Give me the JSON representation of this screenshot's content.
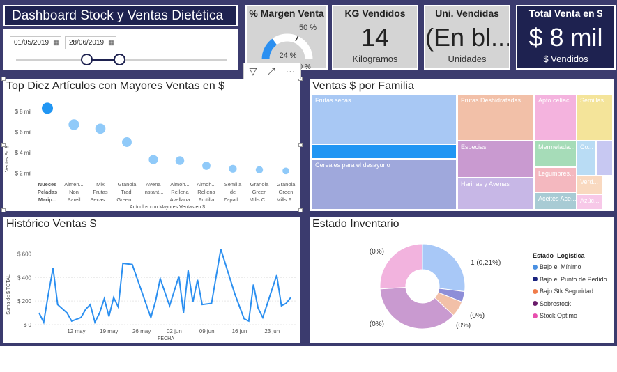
{
  "header": {
    "title": "Dashboard Stock y Ventas Dietética"
  },
  "slicer": {
    "start_date": "01/05/2019",
    "end_date": "28/06/2019",
    "calendar_icon": "calendar-icon"
  },
  "gauge": {
    "title": "% Margen Venta",
    "value_label": "24 %",
    "min_label": "0 %",
    "target_label": "50 %",
    "max_label": "80 %",
    "fill_fraction": 0.3
  },
  "cards": {
    "kg": {
      "title": "KG Vendidos",
      "value": "14",
      "unit": "Kilogramos"
    },
    "units": {
      "title": "Uni. Vendidas",
      "value": "(En bl...",
      "unit": "Unidades"
    },
    "total": {
      "title": "Total Venta en $",
      "value": "$ 8 mil",
      "unit": "$ Vendidos"
    }
  },
  "toolbar": {
    "filter_icon": "filter-icon",
    "focus_icon": "focus-mode-icon",
    "more_icon": "more-options-icon",
    "more_label": "···"
  },
  "top10": {
    "title": "Top Diez Artículos con Mayores Ventas en $",
    "xlabel": "Artículos con Mayores Ventas en $",
    "ylabel": "Ventas En $",
    "ticks": [
      "$ 8 mil",
      "$ 6 mil",
      "$ 4 mil",
      "$ 2 mil"
    ],
    "labels": [
      [
        "Nueces",
        "Peladas",
        "Marip..."
      ],
      [
        "Almen...",
        "Non",
        "Pareil"
      ],
      [
        "Mix",
        "Frutas",
        "Secas ..."
      ],
      [
        "Granola",
        "Trad.",
        "Green ..."
      ],
      [
        "Avena",
        "Instant..."
      ],
      [
        "Almoh...",
        "Rellena",
        "Avellana"
      ],
      [
        "Almoh...",
        "Rellena",
        "Frutilla"
      ],
      [
        "Semilla",
        "de",
        "Zapall..."
      ],
      [
        "Granola",
        "Green",
        "Mills C..."
      ],
      [
        "Granola",
        "Green",
        "Mills F..."
      ]
    ]
  },
  "historico": {
    "title": "Histórico Ventas $",
    "ylabel": "Suma de $ TOTAL",
    "xlabel": "FECHA",
    "yticks": [
      "$ 600",
      "$ 400",
      "$ 200",
      "$ 0"
    ],
    "xticks": [
      "12 may",
      "19 may",
      "26 may",
      "02 jun",
      "09 jun",
      "16 jun",
      "23 jun"
    ]
  },
  "familia": {
    "title": "Ventas $ por Familia",
    "tiles": [
      {
        "label": "Frutas secas",
        "color": "#a8c8f4"
      },
      {
        "label": "Cereales para el desayuno",
        "color": "#9fa8dc"
      },
      {
        "label": "Frutas Deshidratadas",
        "color": "#f2c0a8"
      },
      {
        "label": "Especias",
        "color": "#c99ad0"
      },
      {
        "label": "Harinas y Avenas",
        "color": "#c7b7e6"
      },
      {
        "label": "Apto celíac...",
        "color": "#f4b3de"
      },
      {
        "label": "Semillas",
        "color": "#f4e49a"
      },
      {
        "label": "Mermelada...",
        "color": "#a6dcb8"
      },
      {
        "label": "Co...",
        "color": "#b9dcf4"
      },
      {
        "label": "",
        "color": "#c7c8f2"
      },
      {
        "label": "Legumbres...",
        "color": "#f4b8bf"
      },
      {
        "label": "Verd...",
        "color": "#f9d9c0"
      },
      {
        "label": "Aceites Ace...",
        "color": "#a8cbd4"
      },
      {
        "label": "Azúc...",
        "color": "#f7c8e8"
      }
    ]
  },
  "inventario": {
    "title": "Estado Inventario",
    "legend_title": "Estado_Logistica",
    "legend": [
      {
        "label": "Bajo el Mínimo",
        "color": "#4a90e2"
      },
      {
        "label": "Bajo el Punto de Pedido",
        "color": "#1a237e"
      },
      {
        "label": "Bajo Stk Seguridad",
        "color": "#f07c4a"
      },
      {
        "label": "Sobrestock",
        "color": "#6a1b6a"
      },
      {
        "label": "Stock Optimo",
        "color": "#e84fae"
      }
    ],
    "labels": [
      "(0%)",
      "1 (0,21%)",
      "(0%)",
      "(0%)",
      "(0%)"
    ]
  },
  "chart_data": [
    {
      "type": "scatter",
      "title": "Top Diez Artículos con Mayores Ventas en $",
      "xlabel": "Artículos con Mayores Ventas en $",
      "ylabel": "Ventas En $",
      "categories": [
        "Nueces Peladas Marip...",
        "Almen... Non Pareil",
        "Mix Frutas Secas ...",
        "Granola Trad. Green ...",
        "Avena Instant...",
        "Almoh... Rellena Avellana",
        "Almoh... Rellena Frutilla",
        "Semilla de Zapall...",
        "Granola Green Mills C...",
        "Granola Green Mills F..."
      ],
      "values": [
        8300,
        6700,
        6300,
        5000,
        3300,
        3200,
        2700,
        2400,
        2300,
        2200
      ],
      "ylim": [
        1000,
        9000
      ]
    },
    {
      "type": "line",
      "title": "Histórico Ventas $",
      "xlabel": "FECHA",
      "ylabel": "Suma de $ TOTAL",
      "x": [
        "2019-05-04",
        "2019-05-05",
        "2019-05-06",
        "2019-05-07",
        "2019-05-08",
        "2019-05-10",
        "2019-05-11",
        "2019-05-13",
        "2019-05-14",
        "2019-05-15",
        "2019-05-16",
        "2019-05-17",
        "2019-05-18",
        "2019-05-19",
        "2019-05-20",
        "2019-05-21",
        "2019-05-22",
        "2019-05-24",
        "2019-05-27",
        "2019-05-28",
        "2019-05-29",
        "2019-05-30",
        "2019-06-01",
        "2019-06-03",
        "2019-06-04",
        "2019-06-05",
        "2019-06-06",
        "2019-06-07",
        "2019-06-08",
        "2019-06-10",
        "2019-06-12",
        "2019-06-15",
        "2019-06-17",
        "2019-06-18",
        "2019-06-19",
        "2019-06-20",
        "2019-06-21",
        "2019-06-22",
        "2019-06-24",
        "2019-06-25",
        "2019-06-26",
        "2019-06-27"
      ],
      "y": [
        100,
        20,
        260,
        480,
        170,
        100,
        30,
        60,
        130,
        170,
        20,
        100,
        220,
        70,
        230,
        150,
        520,
        510,
        170,
        60,
        200,
        390,
        160,
        410,
        100,
        460,
        190,
        380,
        170,
        180,
        640,
        260,
        50,
        30,
        340,
        140,
        60,
        180,
        420,
        160,
        180,
        230
      ],
      "ylim": [
        0,
        650
      ]
    },
    {
      "type": "pie",
      "title": "Estado Inventario",
      "categories": [
        "Bajo el Mínimo",
        "Bajo el Punto de Pedido",
        "Bajo Stk Seguridad",
        "Sobrestock",
        "Stock Optimo"
      ],
      "values": [
        27,
        4,
        6,
        37,
        26
      ]
    }
  ]
}
